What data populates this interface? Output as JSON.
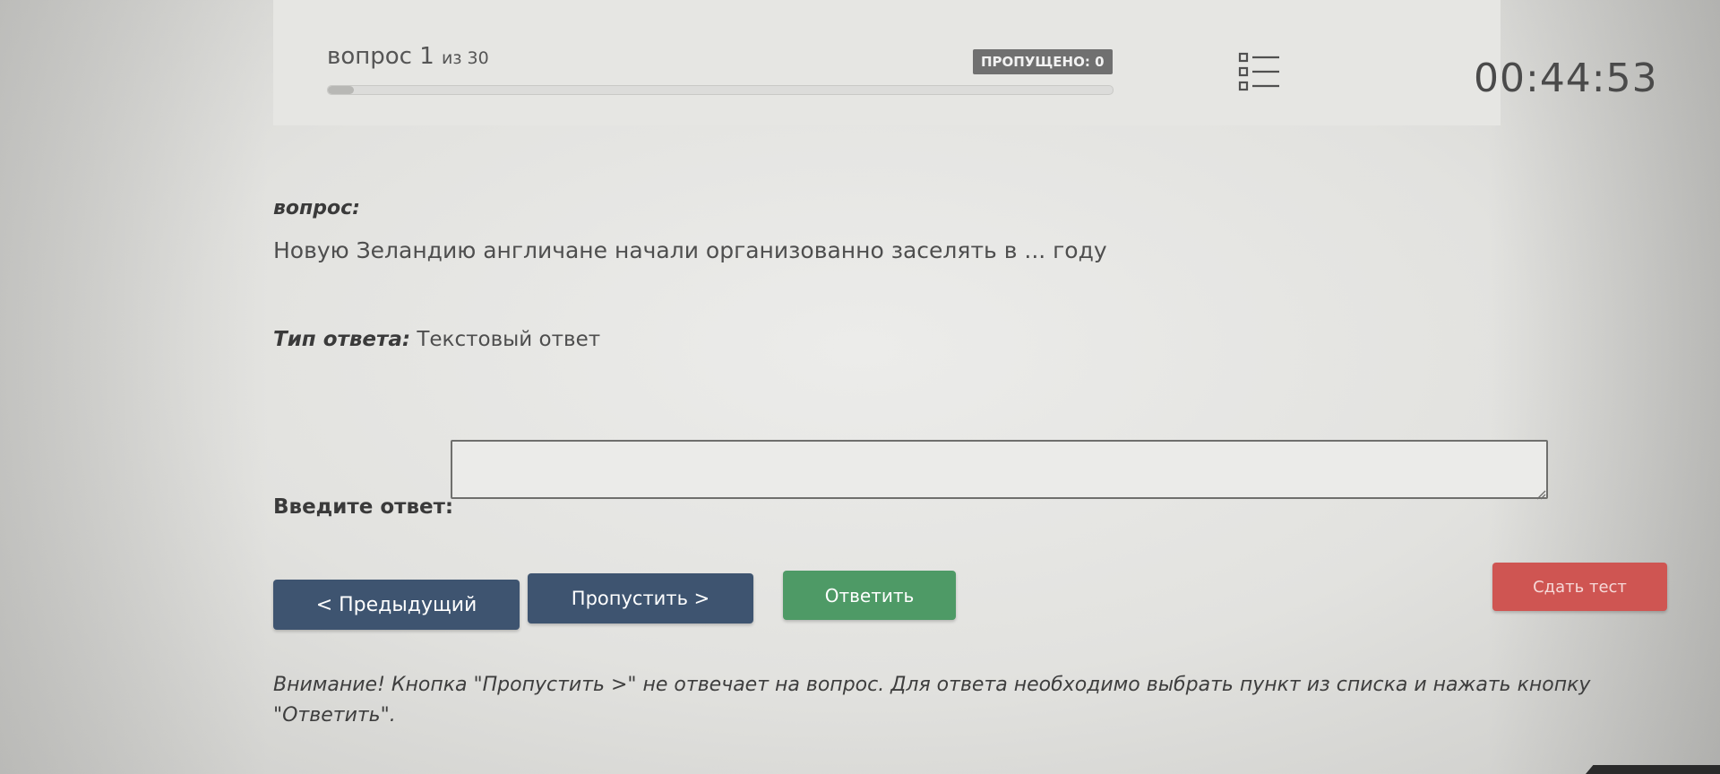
{
  "header": {
    "question_word": "вопрос 1",
    "question_total": "из 30",
    "progress": 0.033,
    "skipped_badge": "ПРОПУЩЕНО: 0",
    "timer": "00:44:53"
  },
  "question": {
    "label": "вопрос:",
    "text": "Новую Зеландию англичане начали организованно заселять в ... году",
    "answer_type_label": "Тип ответа:",
    "answer_type_value": "Текстовый ответ"
  },
  "answer": {
    "label": "Введите ответ:",
    "value": ""
  },
  "buttons": {
    "prev": "< Предыдущий",
    "skip": "Пропустить >",
    "answer": "Ответить",
    "submit": "Сдать тест"
  },
  "warning": {
    "text": "Внимание! Кнопка \"Пропустить >\" не отвечает на вопрос. Для ответа необходимо выбрать пункт из списка и нажать кнопку \"Ответить\"."
  },
  "colors": {
    "nav_button": "#3e5470",
    "answer_button": "#4e9a66",
    "submit_button": "#cf5552",
    "badge": "#707070"
  },
  "icons": {
    "question_list": "list-icon"
  }
}
